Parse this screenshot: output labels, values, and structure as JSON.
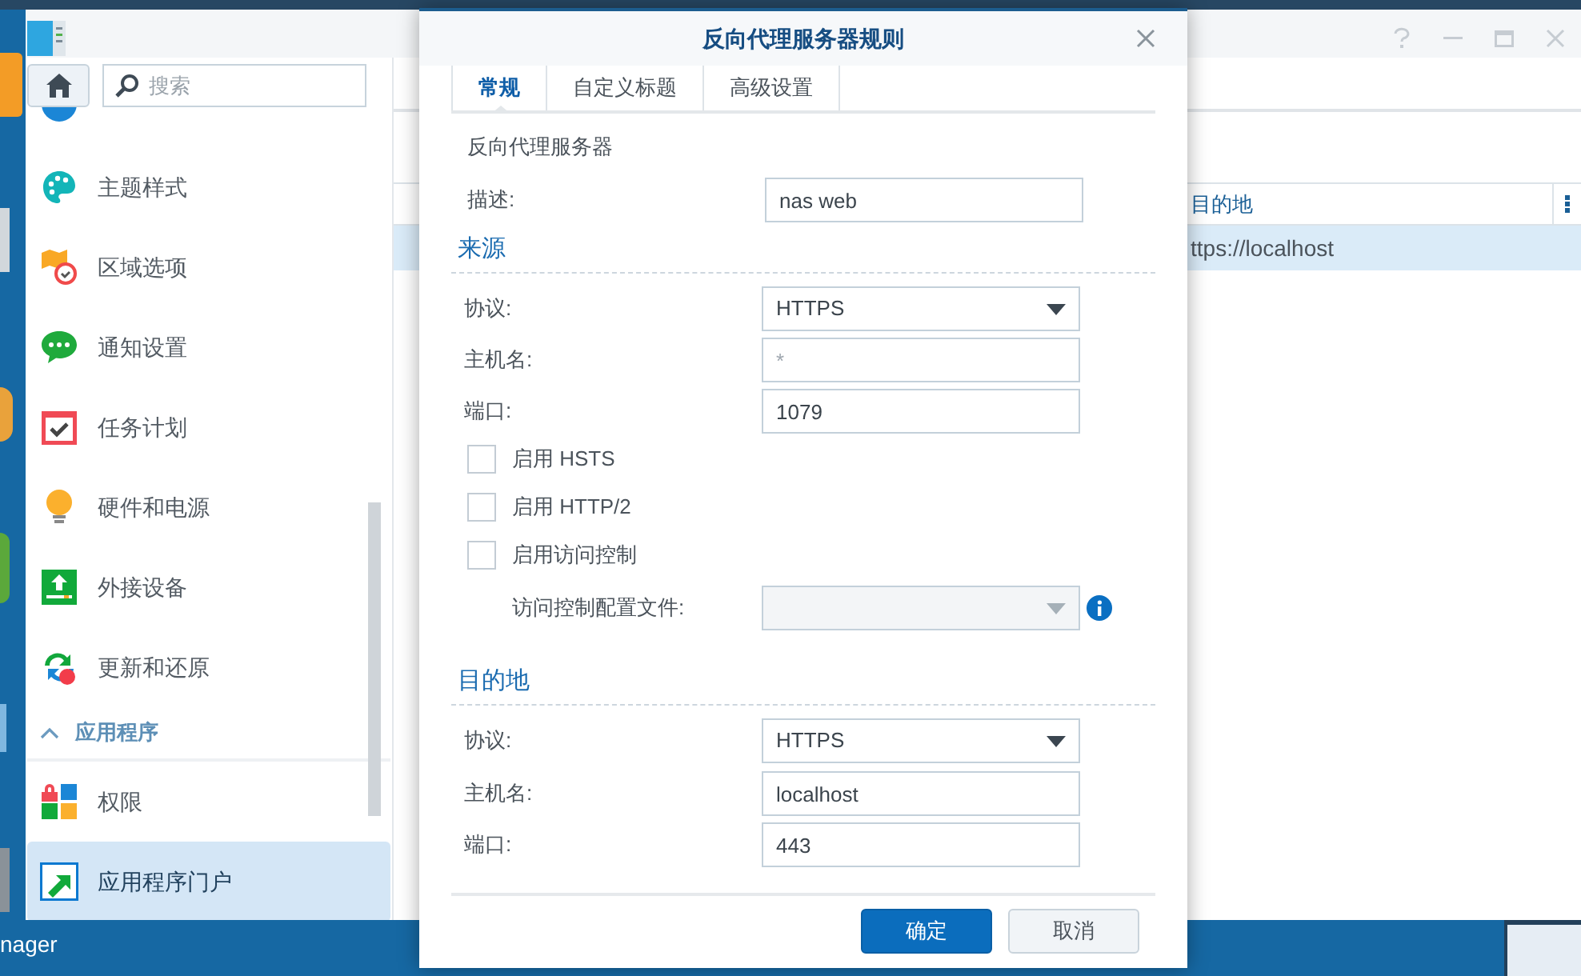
{
  "desktop": {
    "taskbar_label": "nager"
  },
  "window": {
    "search": {
      "placeholder": "搜索"
    },
    "sidebar": {
      "items": [
        {
          "label": "主题样式",
          "selected": false
        },
        {
          "label": "区域选项",
          "selected": false
        },
        {
          "label": "通知设置",
          "selected": false
        },
        {
          "label": "任务计划",
          "selected": false
        },
        {
          "label": "硬件和电源",
          "selected": false
        },
        {
          "label": "外接设备",
          "selected": false
        },
        {
          "label": "更新和还原",
          "selected": false
        }
      ],
      "section": {
        "label": "应用程序",
        "expanded": true,
        "children": [
          {
            "label": "权限",
            "selected": false
          },
          {
            "label": "应用程序门户",
            "selected": true
          }
        ]
      }
    },
    "table": {
      "columns": [
        "目的地"
      ],
      "rows": [
        {
          "column_1": "ttps://localhost",
          "selected": true
        }
      ]
    }
  },
  "dialog": {
    "title": "反向代理服务器规则",
    "tabs": [
      {
        "label": "常规",
        "selected": true
      },
      {
        "label": "自定义标题",
        "selected": false
      },
      {
        "label": "高级设置",
        "selected": false
      }
    ],
    "subtitle": "反向代理服务器",
    "description": {
      "label": "描述:",
      "value": "nas web"
    },
    "source": {
      "heading": "来源",
      "fields": [
        {
          "kind": "select",
          "label": "协议:",
          "value": "HTTPS"
        },
        {
          "kind": "text",
          "label": "主机名:",
          "placeholder": "*"
        },
        {
          "kind": "text",
          "label": "端口:",
          "value": "1079"
        }
      ],
      "options": [
        {
          "label": "启用 HSTS",
          "checked": false
        },
        {
          "label": "启用 HTTP/2",
          "checked": false
        },
        {
          "label": "启用访问控制",
          "checked": false
        }
      ],
      "access_profile": {
        "label": "访问控制配置文件:",
        "disabled": true
      }
    },
    "destination": {
      "heading": "目的地",
      "fields": [
        {
          "kind": "select",
          "label": "协议:",
          "value": "HTTPS"
        },
        {
          "kind": "text",
          "label": "主机名:",
          "value": "localhost"
        },
        {
          "kind": "text",
          "label": "端口:",
          "value": "443"
        }
      ]
    },
    "buttons": [
      {
        "label": "确定",
        "kind": "primary"
      },
      {
        "label": "取消",
        "kind": "secondary"
      }
    ]
  }
}
